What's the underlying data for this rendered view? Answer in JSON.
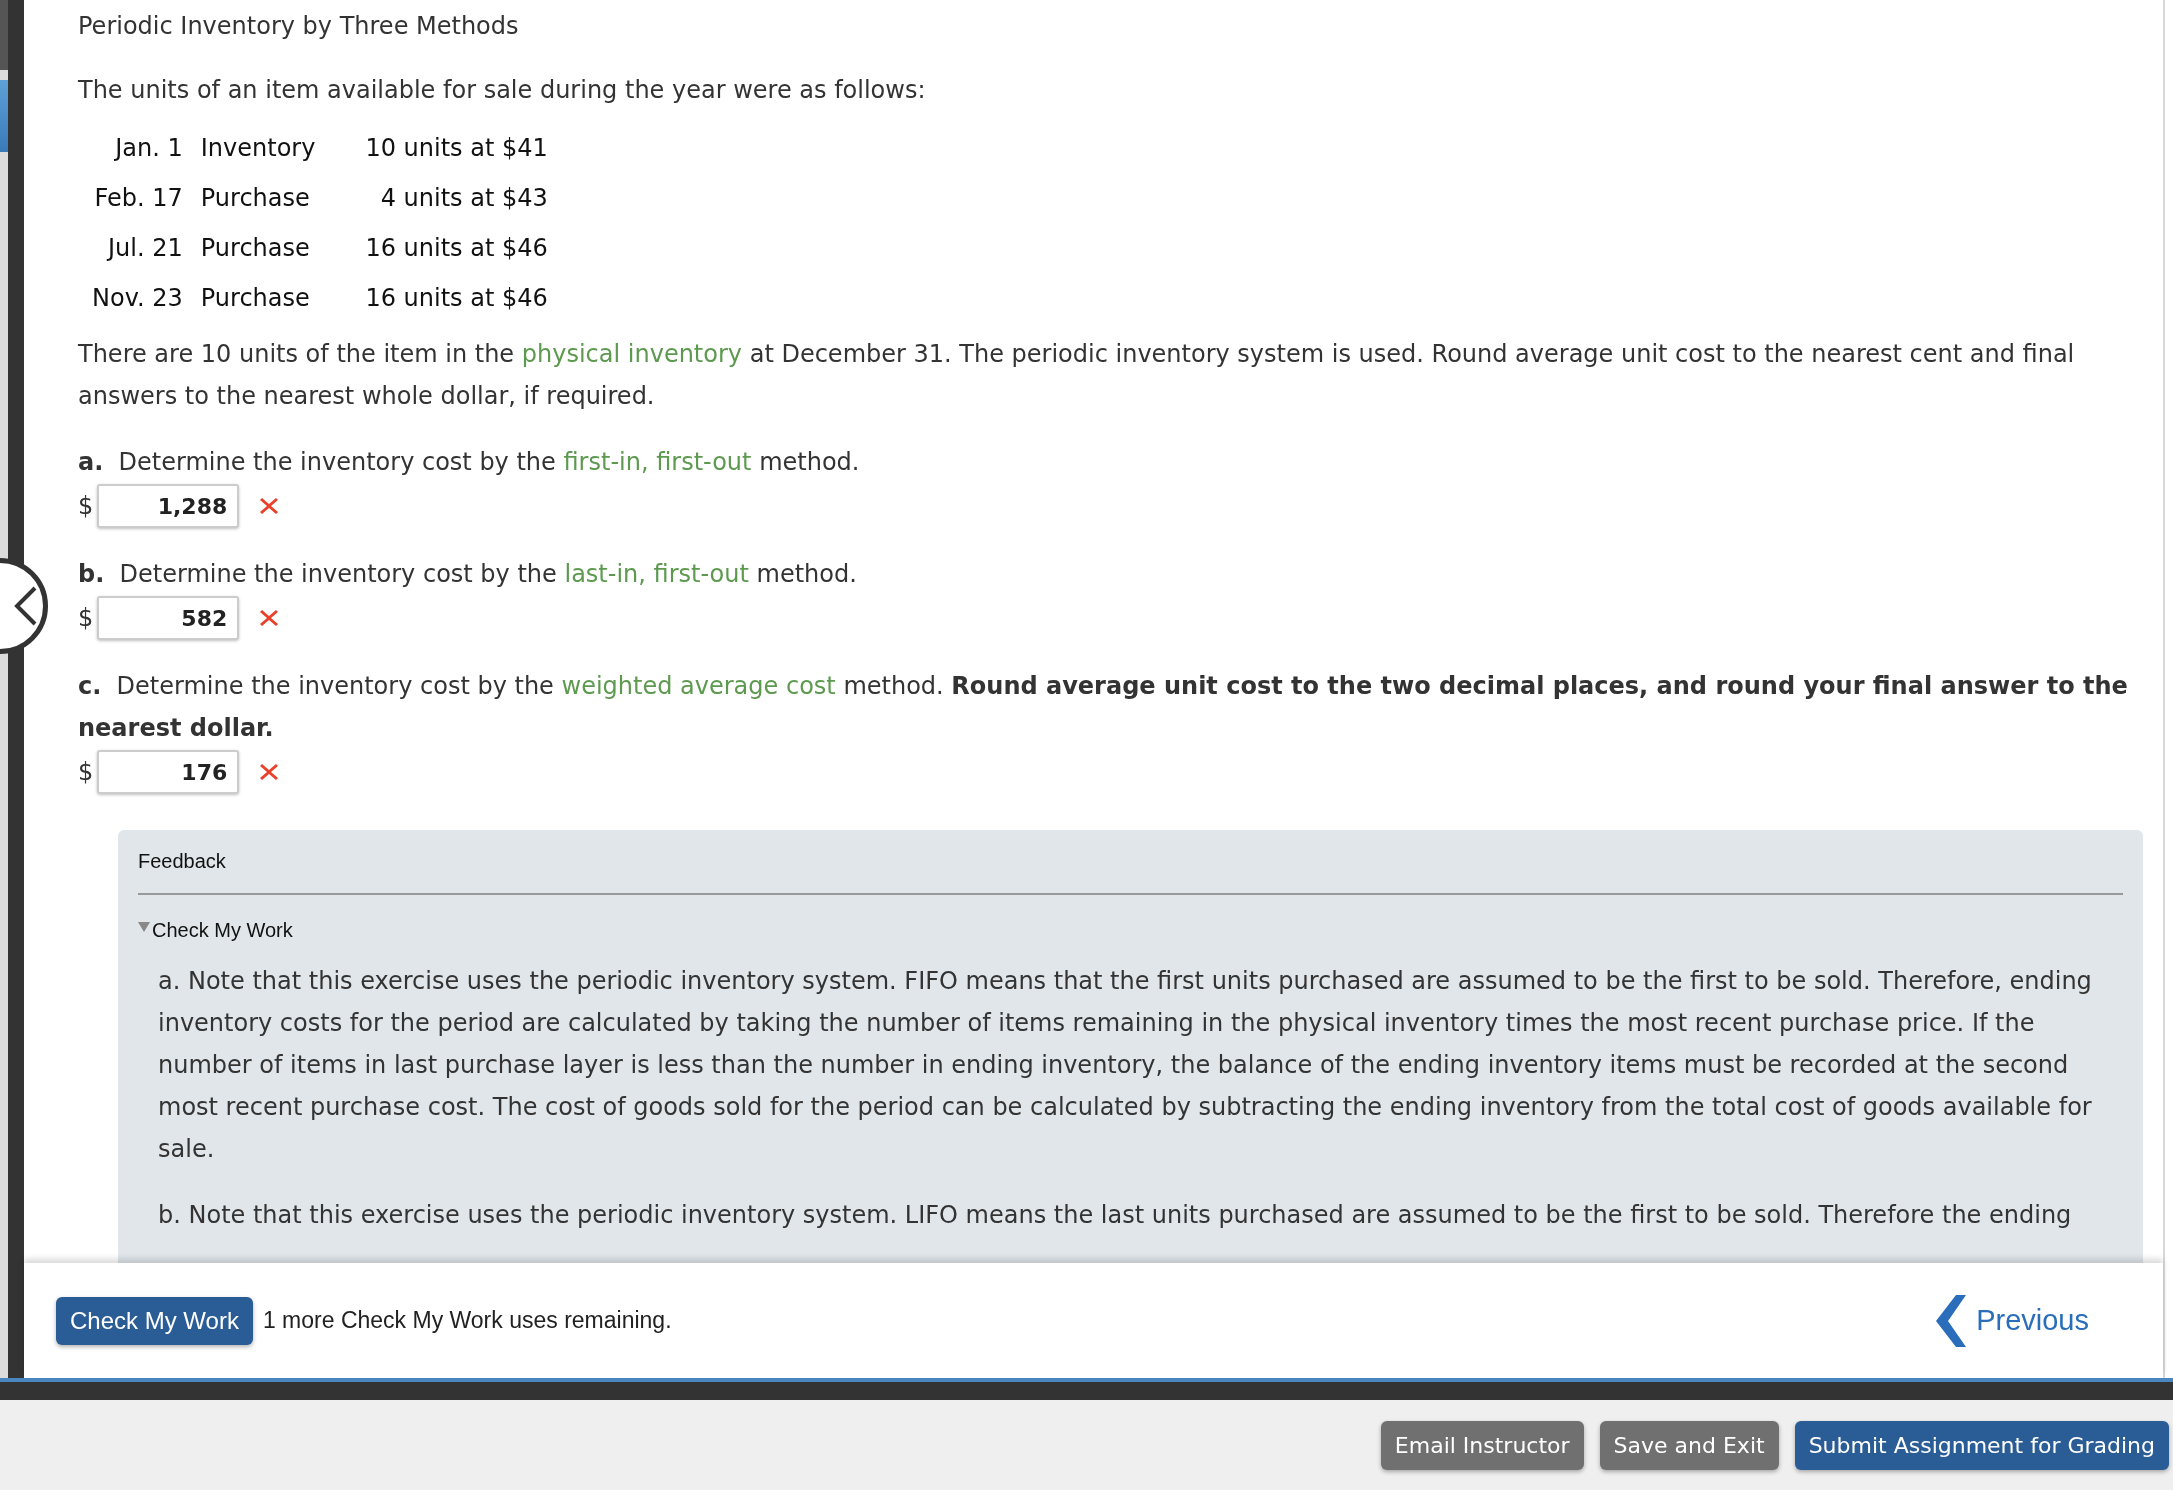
{
  "title": "Periodic Inventory by Three Methods",
  "intro": "The units of an item available for sale during the year were as follows:",
  "schedule": [
    {
      "date": "Jan. 1",
      "description": "Inventory",
      "quantity": "10 units at $41"
    },
    {
      "date": "Feb. 17",
      "description": "Purchase",
      "quantity": "4 units at $43"
    },
    {
      "date": "Jul. 21",
      "description": "Purchase",
      "quantity": "16 units at $46"
    },
    {
      "date": "Nov. 23",
      "description": "Purchase",
      "quantity": "16 units at $46"
    }
  ],
  "instructions": [
    {
      "kind": "plain",
      "text": "There are 10 units of the item in the"
    },
    {
      "kind": "term",
      "text": "physical inventory"
    },
    {
      "kind": "plain",
      "text": "at December 31. The periodic inventory system is used. Round average unit cost to the nearest cent and final answers to the nearest whole dollar, if required."
    }
  ],
  "questions": [
    {
      "letter": "a.",
      "segments": [
        {
          "kind": "plain",
          "text": "Determine the inventory cost by the"
        },
        {
          "kind": "term",
          "text": "first-in, first-out"
        },
        {
          "kind": "plain",
          "text": "method."
        }
      ],
      "currency": "$",
      "answer": "1,288",
      "correct": false
    },
    {
      "letter": "b.",
      "segments": [
        {
          "kind": "plain",
          "text": "Determine the inventory cost by the"
        },
        {
          "kind": "term",
          "text": "last-in, first-out"
        },
        {
          "kind": "plain",
          "text": "method."
        }
      ],
      "currency": "$",
      "answer": "582",
      "correct": false
    },
    {
      "letter": "c.",
      "segments": [
        {
          "kind": "plain",
          "text": "Determine the inventory cost by the"
        },
        {
          "kind": "term",
          "text": "weighted average cost"
        },
        {
          "kind": "plain",
          "text": "method."
        },
        {
          "kind": "bold",
          "text": "Round average unit cost to the two decimal places, and round your final answer to the nearest dollar."
        }
      ],
      "currency": "$",
      "answer": "176",
      "correct": false
    }
  ],
  "feedback": {
    "heading": "Feedback",
    "section": {
      "label": "Check My Work",
      "expanded": true,
      "paragraphs": [
        "a. Note that this exercise uses the periodic inventory system. FIFO means that the first units purchased are assumed to be the first to be sold. Therefore, ending inventory costs for the period are calculated by taking the number of items remaining in the physical inventory times the most recent purchase price. If the number of items in last purchase layer is less than the number in ending inventory, the balance of the ending inventory items must be recorded at the second most recent purchase cost. The cost of goods sold for the period can be calculated by subtracting the ending inventory from the total cost of goods available for sale.",
        "b. Note that this exercise uses the periodic inventory system. LIFO means the last units purchased are assumed to be the first to be sold. Therefore the ending"
      ]
    }
  },
  "footer": {
    "check_button": "Check My Work",
    "remaining": "1 more Check My Work uses remaining.",
    "previous": "Previous"
  },
  "actions": [
    {
      "label": "Email Instructor",
      "kind": "secondary"
    },
    {
      "label": "Save and Exit",
      "kind": "secondary"
    },
    {
      "label": "Submit Assignment for Grading",
      "kind": "primary"
    }
  ]
}
